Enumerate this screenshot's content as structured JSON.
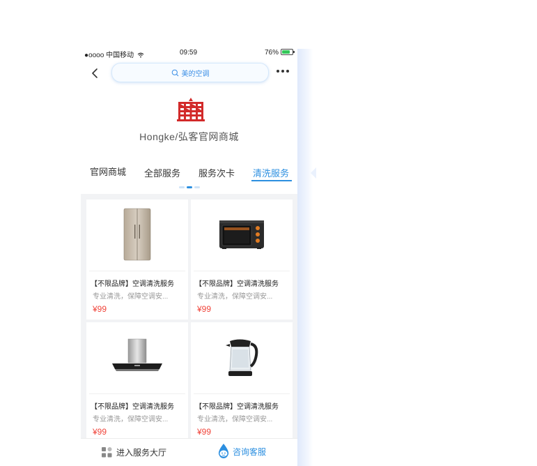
{
  "status_bar": {
    "carrier": "●oooo 中国移动",
    "time": "09:59",
    "battery": "76%"
  },
  "search": {
    "placeholder": "美的空调"
  },
  "shop": {
    "name": "Hongke/弘客官网商城",
    "logo_color": "#d22a2a"
  },
  "tabs": [
    {
      "label": "官网商城",
      "active": false
    },
    {
      "label": "全部服务",
      "active": false
    },
    {
      "label": "服务次卡",
      "active": false
    },
    {
      "label": "清洗服务",
      "active": true
    }
  ],
  "accent_color": "#2c8fe0",
  "price_color": "#f0443a",
  "products": [
    {
      "image": "refrigerator-image",
      "title": "【不限品牌】空调清洗服务",
      "desc": "专业清洗，保障空调安...",
      "price": "¥99"
    },
    {
      "image": "oven-image",
      "title": "【不限品牌】空调清洗服务",
      "desc": "专业清洗，保障空调安...",
      "price": "¥99"
    },
    {
      "image": "range-hood-image",
      "title": "【不限品牌】空调清洗服务",
      "desc": "专业清洗，保障空调安...",
      "price": "¥99"
    },
    {
      "image": "kettle-image",
      "title": "【不限品牌】空调清洗服务",
      "desc": "专业清洗，保障空调安...",
      "price": "¥99"
    }
  ],
  "bottom_bar": {
    "hall_label": "进入服务大厅",
    "service_label": "咨询客服"
  }
}
